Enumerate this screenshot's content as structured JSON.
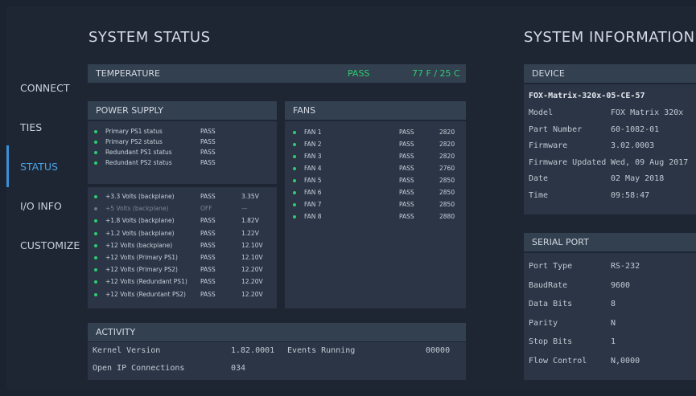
{
  "sidebar": {
    "items": [
      {
        "label": "CONNECT",
        "active": false
      },
      {
        "label": "TIES",
        "active": false
      },
      {
        "label": "STATUS",
        "active": true
      },
      {
        "label": "I/O INFO",
        "active": false
      },
      {
        "label": "CUSTOMIZE",
        "active": false
      }
    ]
  },
  "status": {
    "title": "SYSTEM STATUS",
    "temperature": {
      "label": "TEMPERATURE",
      "status": "PASS",
      "value": "77 F / 25 C"
    },
    "power_supply": {
      "label": "POWER SUPPLY",
      "status_rows": [
        {
          "name": "Primary PS1 status",
          "status": "PASS"
        },
        {
          "name": "Primary PS2 status",
          "status": "PASS"
        },
        {
          "name": "Redundant PS1 status",
          "status": "PASS"
        },
        {
          "name": "Redundant PS2 status",
          "status": "PASS"
        }
      ],
      "voltage_rows": [
        {
          "name": "+3.3 Volts (backplane)",
          "status": "PASS",
          "value": "3.35V",
          "on": true
        },
        {
          "name": "+5 Volts (backplane)",
          "status": "OFF",
          "value": "—",
          "on": false
        },
        {
          "name": "+1.8 Volts (backplane)",
          "status": "PASS",
          "value": "1.82V",
          "on": true
        },
        {
          "name": "+1.2 Volts (backplane)",
          "status": "PASS",
          "value": "1.22V",
          "on": true
        },
        {
          "name": "+12 Volts (backplane)",
          "status": "PASS",
          "value": "12.10V",
          "on": true
        },
        {
          "name": "+12 Volts (Primary PS1)",
          "status": "PASS",
          "value": "12.10V",
          "on": true
        },
        {
          "name": "+12 Volts (Primary PS2)",
          "status": "PASS",
          "value": "12.20V",
          "on": true
        },
        {
          "name": "+12 Volts (Redundant PS1)",
          "status": "PASS",
          "value": "12.20V",
          "on": true
        },
        {
          "name": "+12 Volts (Reduntant PS2)",
          "status": "PASS",
          "value": "12.20V",
          "on": true
        }
      ]
    },
    "fans": {
      "label": "FANS",
      "rows": [
        {
          "name": "FAN 1",
          "status": "PASS",
          "rpm": "2820"
        },
        {
          "name": "FAN 2",
          "status": "PASS",
          "rpm": "2820"
        },
        {
          "name": "FAN 3",
          "status": "PASS",
          "rpm": "2820"
        },
        {
          "name": "FAN 4",
          "status": "PASS",
          "rpm": "2760"
        },
        {
          "name": "FAN 5",
          "status": "PASS",
          "rpm": "2850"
        },
        {
          "name": "FAN 6",
          "status": "PASS",
          "rpm": "2850"
        },
        {
          "name": "FAN 7",
          "status": "PASS",
          "rpm": "2850"
        },
        {
          "name": "FAN 8",
          "status": "PASS",
          "rpm": "2880"
        }
      ]
    },
    "activity": {
      "label": "ACTIVITY",
      "kernel_label": "Kernel Version",
      "kernel_value": "1.82.0001",
      "events_label": "Events Running",
      "events_value": "00000",
      "ip_label": "Open IP Connections",
      "ip_value": "034"
    }
  },
  "info": {
    "title": "SYSTEM INFORMATION",
    "device": {
      "label": "DEVICE",
      "name": "FOX-Matrix-320x-05-CE-57",
      "rows": [
        {
          "key": "Model",
          "value": "FOX Matrix 320x"
        },
        {
          "key": "Part Number",
          "value": "60-1082-01"
        },
        {
          "key": "Firmware",
          "value": "3.02.0003"
        },
        {
          "key": "Firmware Updated",
          "value": "Wed, 09 Aug 2017"
        },
        {
          "key": "Date",
          "value": "02 May 2018"
        },
        {
          "key": "Time",
          "value": "09:58:47"
        }
      ]
    },
    "serial": {
      "label": "SERIAL PORT",
      "rows": [
        {
          "key": "Port Type",
          "value": "RS-232"
        },
        {
          "key": "BaudRate",
          "value": "9600"
        },
        {
          "key": "Data Bits",
          "value": "8"
        },
        {
          "key": "Parity",
          "value": "N"
        },
        {
          "key": "Stop Bits",
          "value": "1"
        },
        {
          "key": "Flow Control",
          "value": "N,0000"
        }
      ]
    }
  },
  "colors": {
    "accent": "#3c8fd6",
    "pass": "#2ecc71",
    "panel": "#2b3545",
    "header": "#33404f"
  }
}
